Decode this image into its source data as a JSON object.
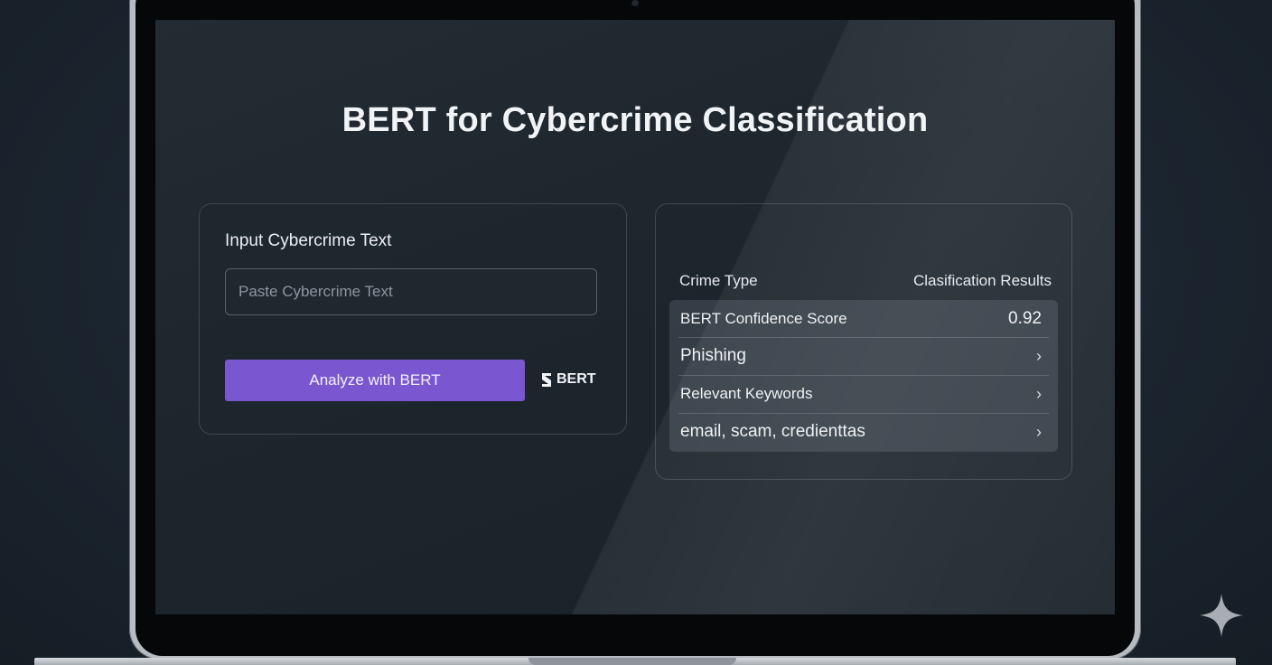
{
  "app": {
    "title": "BERT for Cybercrime Classification"
  },
  "input_panel": {
    "heading": "Input Cybercrime Text",
    "text_field": {
      "value": "",
      "placeholder": "Paste Cybercrime Text"
    },
    "analyze_button_label": "Analyze with BERT",
    "logo_text": "BERT"
  },
  "results_panel": {
    "header_left": "Crime Type",
    "header_right": "Clasification Results",
    "rows": [
      {
        "label": "BERT Confidence Score",
        "value": "0.92"
      },
      {
        "label": "Phishing"
      },
      {
        "label": "Relevant Keywords"
      },
      {
        "label": "email, scam, credienttas"
      }
    ]
  },
  "colors": {
    "accent_button": "#7a57d1",
    "screen_background": "#1d252d",
    "text_primary": "#f1f3f5"
  },
  "icons": [
    "bert-logo-icon",
    "chevron-right-icon",
    "sparkle-icon"
  ]
}
